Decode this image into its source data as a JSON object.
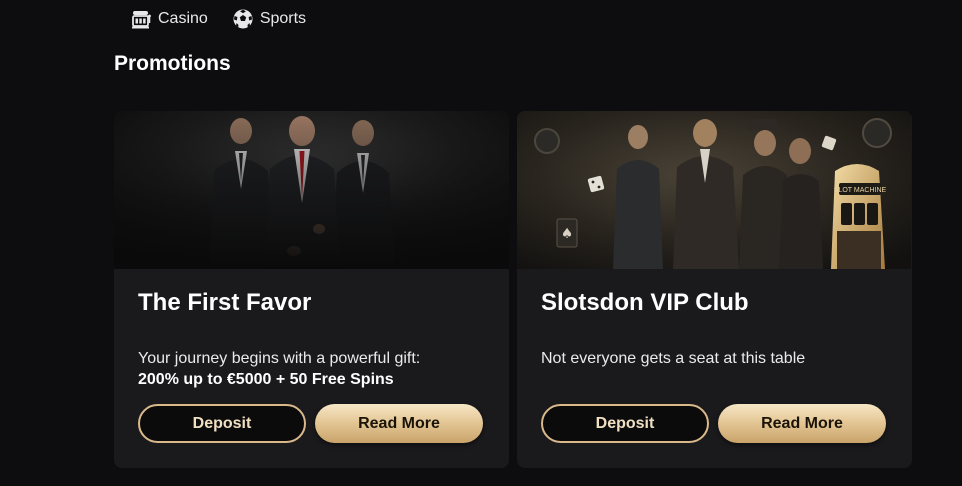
{
  "nav": {
    "items": [
      {
        "label": "Casino",
        "icon": "slot-machine-icon"
      },
      {
        "label": "Sports",
        "icon": "soccer-ball-icon"
      }
    ]
  },
  "promotions": {
    "title": "Promotions",
    "cards": [
      {
        "title": "The First Favor",
        "description": "Your journey begins with a powerful gift:",
        "highlight": "200% up to €5000 + 50 Free Spins",
        "deposit_label": "Deposit",
        "read_more_label": "Read More"
      },
      {
        "title": "Slotsdon VIP Club",
        "description": "Not everyone gets a seat at this table",
        "highlight": "",
        "deposit_label": "Deposit",
        "read_more_label": "Read More",
        "image_text": "SLOT MACHINE"
      }
    ]
  },
  "colors": {
    "background": "#0d0d0f",
    "card": "#1a1a1d",
    "gold": "#d9b98a"
  }
}
